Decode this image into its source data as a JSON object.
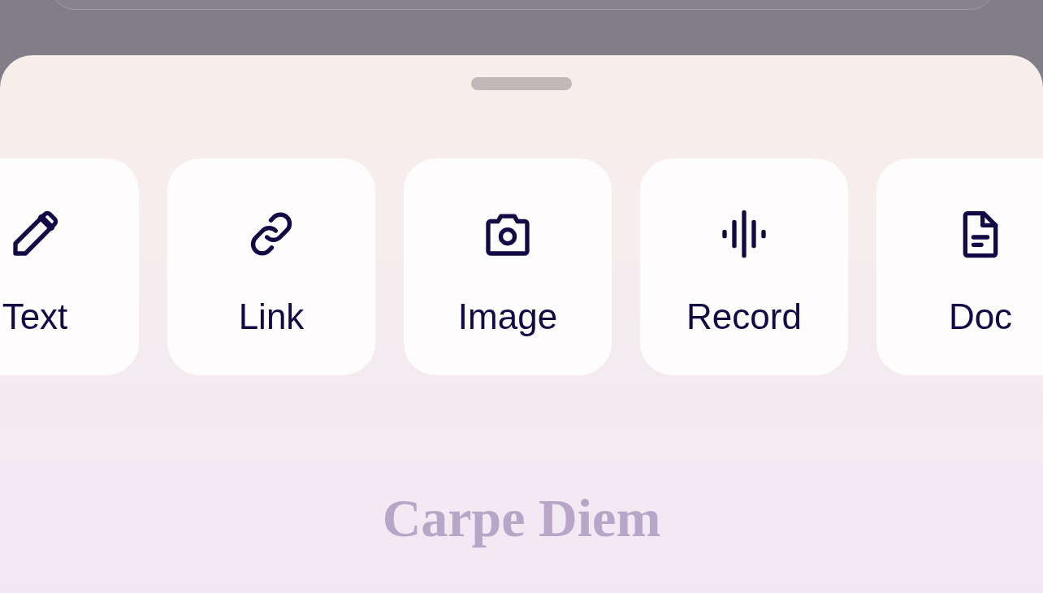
{
  "sheet": {
    "options": [
      {
        "kind": "text",
        "label": "Text"
      },
      {
        "kind": "link",
        "label": "Link"
      },
      {
        "kind": "image",
        "label": "Image"
      },
      {
        "kind": "record",
        "label": "Record"
      },
      {
        "kind": "doc",
        "label": "Doc"
      }
    ],
    "footer_title": "Carpe Diem"
  }
}
